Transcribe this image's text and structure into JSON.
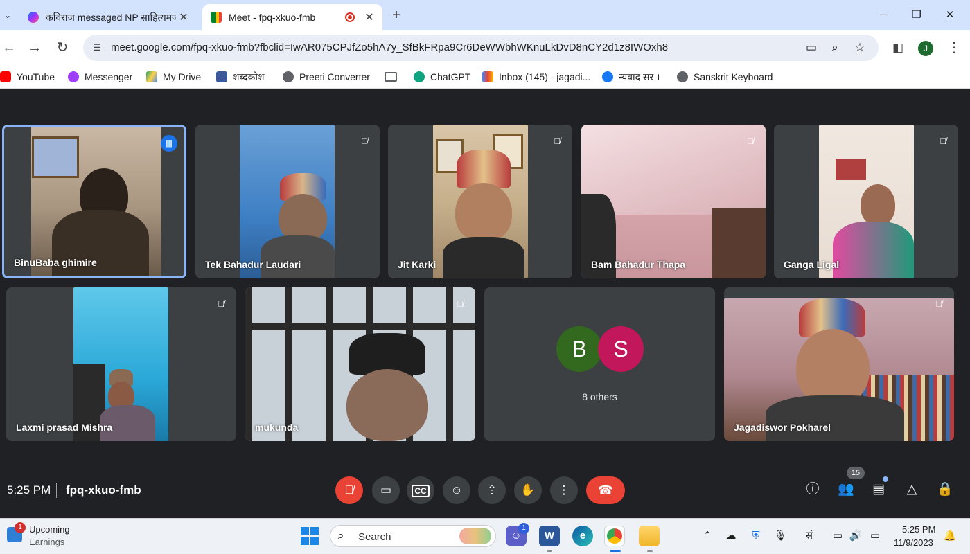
{
  "browser": {
    "tabs": [
      {
        "title": "कविराज messaged NP साहित्यमञ्च",
        "favicon": "messenger-icon",
        "active": false
      },
      {
        "title": "Meet - fpq-xkuo-fmb",
        "favicon": "google-meet-icon",
        "active": true
      }
    ],
    "tab_close_glyph": "✕",
    "new_tab_glyph": "+",
    "url": "meet.google.com/fpq-xkuo-fmb?fbclid=IwAR075CPJfZo5hA7y_SfBkFRpa9Cr6DeWWbhWKnuLkDvD8nCY2d1z8IWOxh8",
    "profile_initial": "J",
    "bookmarks": [
      {
        "label": "YouTube",
        "icon": "youtube-icon",
        "color": "#ff0000"
      },
      {
        "label": "Messenger",
        "icon": "messenger-icon",
        "color": "#a03ffb"
      },
      {
        "label": "My Drive",
        "icon": "google-drive-icon",
        "color": "#1fa463"
      },
      {
        "label": "शब्दकोश",
        "icon": "dictionary-icon",
        "color": "#3b5998"
      },
      {
        "label": "Preeti Converter",
        "icon": "globe-icon",
        "color": "#5f6368"
      },
      {
        "label": "",
        "icon": "folder-icon",
        "color": "#5f6368"
      },
      {
        "label": "ChatGPT",
        "icon": "chatgpt-icon",
        "color": "#10a37f"
      },
      {
        "label": "Inbox (145) - jagadi...",
        "icon": "gmail-icon",
        "color": "#ea4335"
      },
      {
        "label": "न्यवाद सर ।",
        "icon": "facebook-icon",
        "color": "#1877f2"
      },
      {
        "label": "Sanskrit Keyboard",
        "icon": "globe-icon",
        "color": "#5f6368"
      }
    ]
  },
  "meet": {
    "participants": [
      {
        "name": "BinuBaba ghimire",
        "speaking": true
      },
      {
        "name": "Tek Bahadur Laudari",
        "muted": true
      },
      {
        "name": "Jit Karki",
        "muted": true
      },
      {
        "name": "Bam Bahadur Thapa",
        "muted": true
      },
      {
        "name": "Ganga Ligal",
        "muted": true
      },
      {
        "name": "Laxmi prasad Mishra",
        "muted": true
      },
      {
        "name": "mukunda",
        "muted": true
      },
      {
        "name": "Jagadiswor Pokharel",
        "muted": true
      }
    ],
    "others": {
      "avatars": [
        {
          "initial": "B",
          "color": "#33691e"
        },
        {
          "initial": "S",
          "color": "#c2185b"
        }
      ],
      "label": "8 others"
    },
    "time": "5:25 PM",
    "divider": "|",
    "meeting_code": "fpq-xkuo-fmb",
    "people_count": "15",
    "accent": "#ea4335"
  },
  "taskbar": {
    "widget_title": "Upcoming",
    "widget_subtitle": "Earnings",
    "widget_badge": "1",
    "search_label": "Search",
    "teams_badge": "1",
    "tray_lang": "सं",
    "clock_time": "5:25 PM",
    "clock_date": "11/9/2023"
  }
}
